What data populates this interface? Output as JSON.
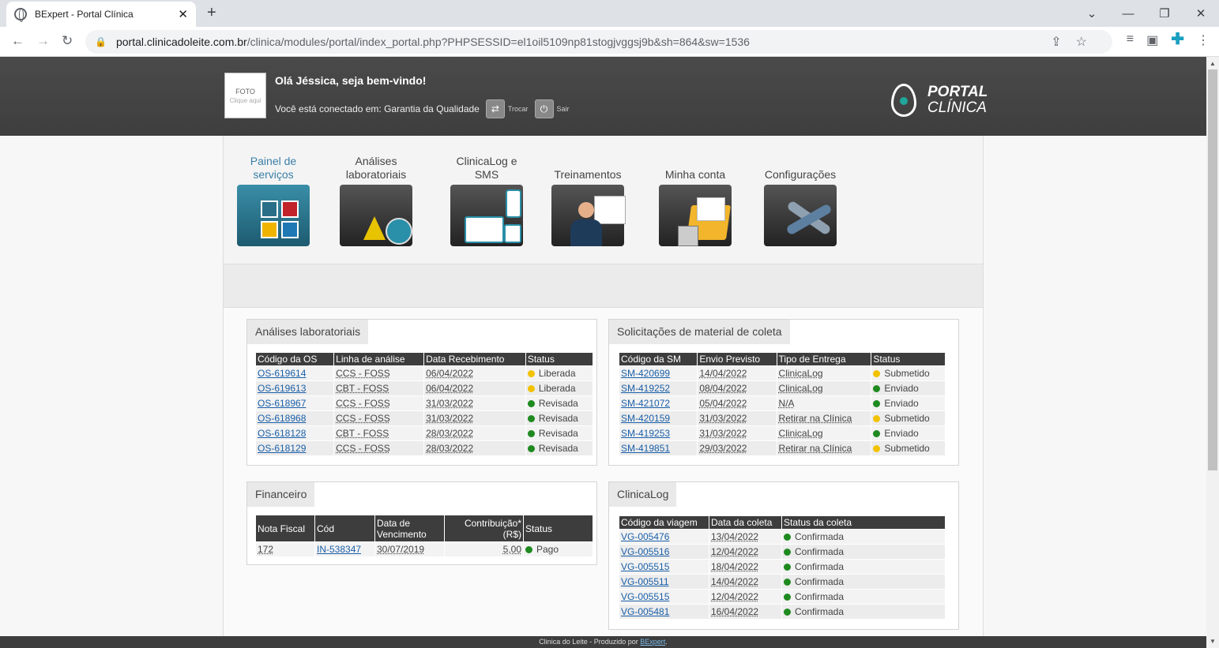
{
  "browser": {
    "tab_title": "BExpert - Portal Clínica",
    "url_host": "portal.clinicadoleite.com.br",
    "url_path": "/clinica/modules/portal/index_portal.php?PHPSESSID=el1oil5109np81stogjvggsj9b&sh=864&sw=1536"
  },
  "header": {
    "photo_line1": "FOTO",
    "photo_line2": "Clique aqui",
    "greeting": "Olá Jéssica, seja bem-vindo!",
    "connected_label": "Você está conectado em: Garantia da Qualidade",
    "switch_label": "Trocar",
    "exit_label": "Sair",
    "logo_line1": "PORTAL",
    "logo_line2": "CLÍNICA"
  },
  "menu": {
    "items": [
      {
        "label": "Painel de serviços",
        "icon": "services-panel-icon"
      },
      {
        "label": "Análises laboratoriais",
        "icon": "lab-flask-icon"
      },
      {
        "label": "ClinicaLog e SMS",
        "icon": "truck-phone-icon"
      },
      {
        "label": "Treinamentos",
        "icon": "training-presenter-icon"
      },
      {
        "label": "Minha conta",
        "icon": "account-folder-icon"
      },
      {
        "label": "Configurações",
        "icon": "wrench-tools-icon"
      }
    ]
  },
  "analises": {
    "title": "Análises laboratoriais",
    "headers": [
      "Código da OS",
      "Linha de análise",
      "Data Recebimento",
      "Status"
    ],
    "rows": [
      {
        "code": "OS-619614",
        "line": "CCS - FOSS",
        "date": "06/04/2022",
        "status": "Liberada",
        "color": "#f2c200"
      },
      {
        "code": "OS-619613",
        "line": "CBT - FOSS",
        "date": "06/04/2022",
        "status": "Liberada",
        "color": "#f2c200"
      },
      {
        "code": "OS-618967",
        "line": "CCS - FOSS",
        "date": "31/03/2022",
        "status": "Revisada",
        "color": "#1f8a1f"
      },
      {
        "code": "OS-618968",
        "line": "CCS - FOSS",
        "date": "31/03/2022",
        "status": "Revisada",
        "color": "#1f8a1f"
      },
      {
        "code": "OS-618128",
        "line": "CBT - FOSS",
        "date": "28/03/2022",
        "status": "Revisada",
        "color": "#1f8a1f"
      },
      {
        "code": "OS-618129",
        "line": "CCS - FOSS",
        "date": "28/03/2022",
        "status": "Revisada",
        "color": "#1f8a1f"
      }
    ]
  },
  "solicitacoes": {
    "title": "Solicitações de material de coleta",
    "headers": [
      "Código da SM",
      "Envio Previsto",
      "Tipo de Entrega",
      "Status"
    ],
    "rows": [
      {
        "code": "SM-420699",
        "date": "14/04/2022",
        "type": "ClinicaLog",
        "status": "Submetido",
        "color": "#f2c200"
      },
      {
        "code": "SM-419252",
        "date": "08/04/2022",
        "type": "ClinicaLog",
        "status": "Enviado",
        "color": "#1f8a1f"
      },
      {
        "code": "SM-421072",
        "date": "05/04/2022",
        "type": "N/A",
        "status": "Enviado",
        "color": "#1f8a1f"
      },
      {
        "code": "SM-420159",
        "date": "31/03/2022",
        "type": "Retirar na Clínica",
        "status": "Submetido",
        "color": "#f2c200"
      },
      {
        "code": "SM-419253",
        "date": "31/03/2022",
        "type": "ClinicaLog",
        "status": "Enviado",
        "color": "#1f8a1f"
      },
      {
        "code": "SM-419851",
        "date": "29/03/2022",
        "type": "Retirar na Clínica",
        "status": "Submetido",
        "color": "#f2c200"
      }
    ]
  },
  "financeiro": {
    "title": "Financeiro",
    "headers": [
      "Nota Fiscal",
      "Cód",
      "Data de Vencimento",
      "Contribuição* (R$)",
      "Status"
    ],
    "rows": [
      {
        "nf": "172",
        "code": "IN-538347",
        "date": "30/07/2019",
        "value": "5,00",
        "status": "Pago",
        "color": "#1f8a1f"
      }
    ]
  },
  "clinicalog": {
    "title": "ClinicaLog",
    "headers": [
      "Código da viagem",
      "Data da coleta",
      "Status da coleta"
    ],
    "rows": [
      {
        "code": "VG-005476",
        "date": "13/04/2022",
        "status": "Confirmada",
        "color": "#1f8a1f"
      },
      {
        "code": "VG-005516",
        "date": "12/04/2022",
        "status": "Confirmada",
        "color": "#1f8a1f"
      },
      {
        "code": "VG-005515",
        "date": "18/04/2022",
        "status": "Confirmada",
        "color": "#1f8a1f"
      },
      {
        "code": "VG-005511",
        "date": "14/04/2022",
        "status": "Confirmada",
        "color": "#1f8a1f"
      },
      {
        "code": "VG-005515",
        "date": "12/04/2022",
        "status": "Confirmada",
        "color": "#1f8a1f"
      },
      {
        "code": "VG-005481",
        "date": "16/04/2022",
        "status": "Confirmada",
        "color": "#1f8a1f"
      }
    ]
  },
  "footer": {
    "text": "Clinica do Leite - Produzido por ",
    "link": "BExpert",
    "suffix": "."
  }
}
